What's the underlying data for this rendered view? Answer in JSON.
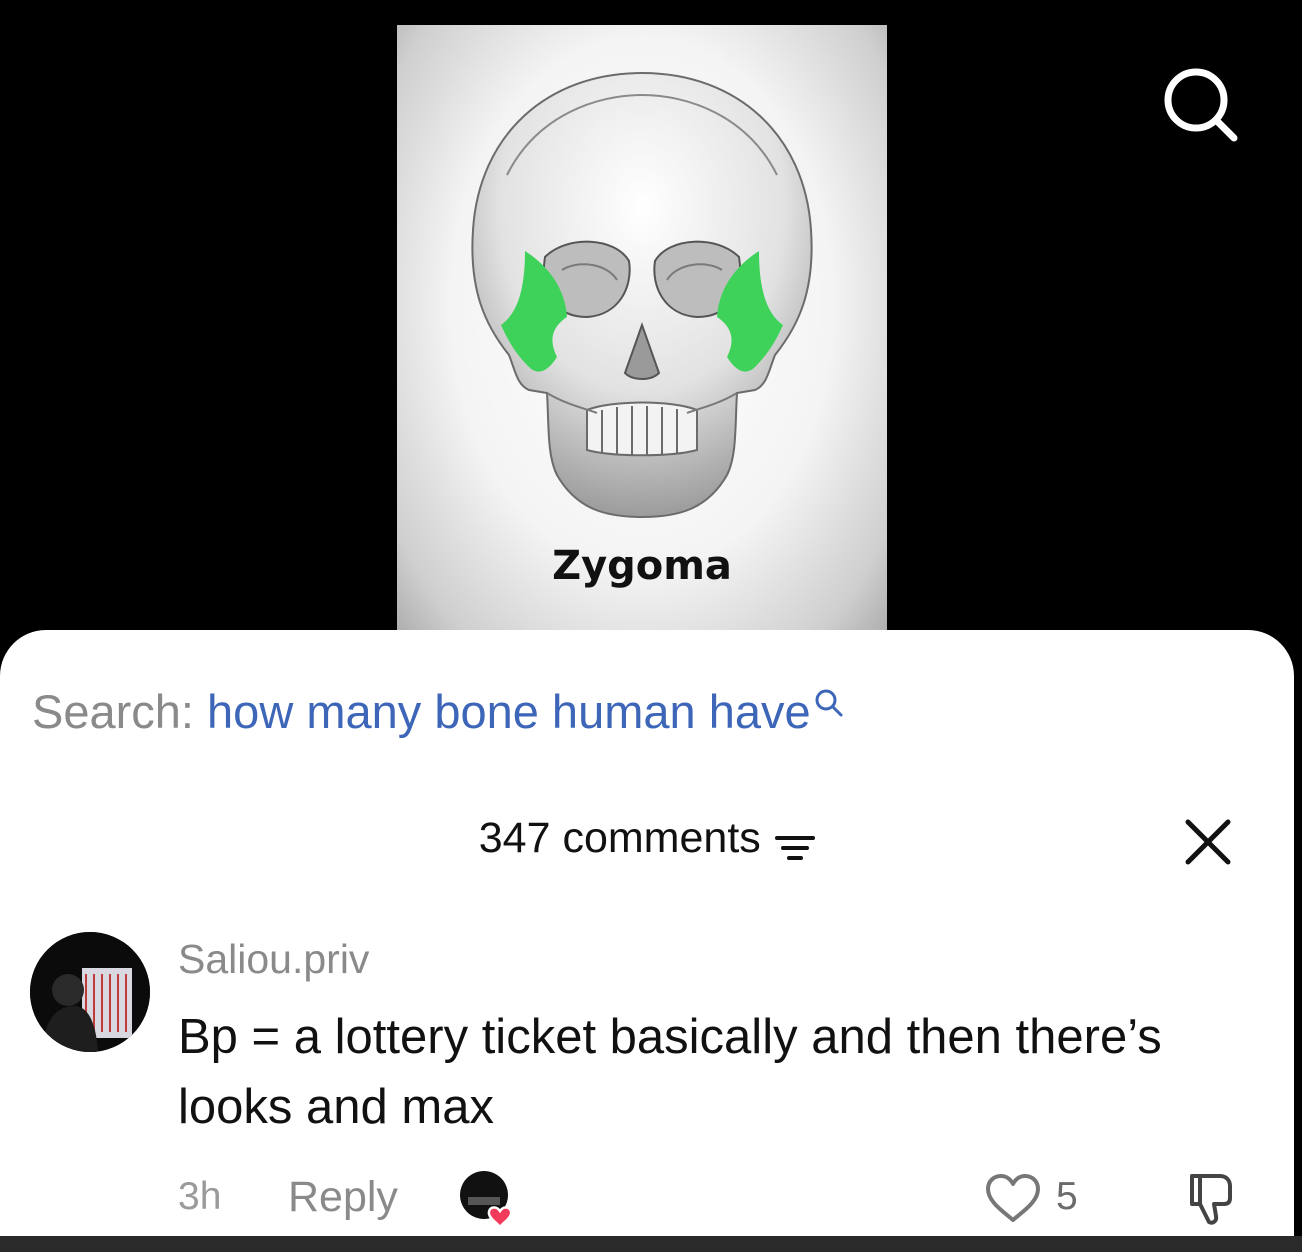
{
  "video": {
    "caption": "Zygoma",
    "highlight_color": "#3fd25a"
  },
  "top_icons": {
    "search": "search-icon"
  },
  "search_bar": {
    "label": "Search:",
    "query": "how many bone human have",
    "query_color": "#3d66b8",
    "icon": "search-icon"
  },
  "comments": {
    "count_label": "347 comments",
    "sort_icon": "filter-icon",
    "close_icon": "close-icon",
    "items": [
      {
        "username": "Saliou.priv",
        "text": "Bp = a lottery ticket basically and then there’s looks and max",
        "time": "3h",
        "reply_label": "Reply",
        "likes": "5",
        "liked_by_creator": true
      }
    ]
  }
}
